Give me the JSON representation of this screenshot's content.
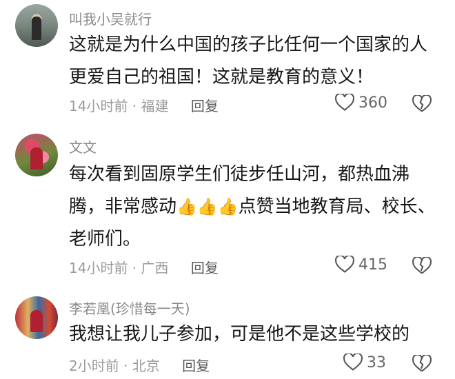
{
  "comments": [
    {
      "username": "叫我小吴就行",
      "text": "这就是为什么中国的孩子比任何一个国家的人更爱自己的祖国！这就是教育的意义！",
      "time": "14小时前",
      "location": "福建",
      "reply_label": "回复",
      "likes": "360"
    },
    {
      "username": "文文",
      "text_before_emoji": "每次看到固原学生们徒步任山河，都热血沸腾，非常感动",
      "emoji": "👍👍👍",
      "text_after_emoji": "点赞当地教育局、校长、老师们。",
      "time": "14小时前",
      "location": "广西",
      "reply_label": "回复",
      "likes": "415"
    },
    {
      "username": "李若凰(珍惜每一天)",
      "text": "我想让我儿子参加，可是他不是这些学校的",
      "time": "2小时前",
      "location": "北京",
      "reply_label": "回复",
      "likes": "33"
    }
  ],
  "separator": " · ",
  "icons": {
    "like": "heart-icon",
    "dislike": "broken-heart-icon"
  }
}
